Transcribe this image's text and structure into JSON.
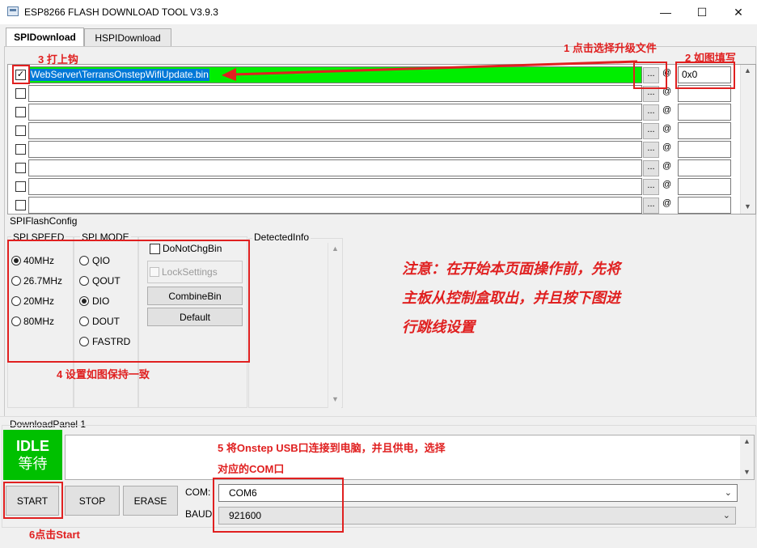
{
  "window": {
    "title": "ESP8266 FLASH DOWNLOAD TOOL V3.9.3",
    "minimize": "—",
    "maximize": "☐",
    "close": "✕"
  },
  "tabs": [
    {
      "label": "SPIDownload",
      "active": true
    },
    {
      "label": "HSPIDownload",
      "active": false
    }
  ],
  "files": [
    {
      "checked": true,
      "path": "WebServer\\TerransOnstepWifiUpdate.bin",
      "address": "0x0"
    },
    {
      "checked": false,
      "path": "",
      "address": ""
    },
    {
      "checked": false,
      "path": "",
      "address": ""
    },
    {
      "checked": false,
      "path": "",
      "address": ""
    },
    {
      "checked": false,
      "path": "",
      "address": ""
    },
    {
      "checked": false,
      "path": "",
      "address": ""
    },
    {
      "checked": false,
      "path": "",
      "address": ""
    },
    {
      "checked": false,
      "path": "",
      "address": ""
    }
  ],
  "browse_label": "...",
  "at_label": "@",
  "spiflash": {
    "title": "SPIFlashConfig",
    "speed_title": "SPI SPEED",
    "speeds": [
      "40MHz",
      "26.7MHz",
      "20MHz",
      "80MHz"
    ],
    "speed_selected": "40MHz",
    "mode_title": "SPI MODE",
    "modes": [
      "QIO",
      "QOUT",
      "DIO",
      "DOUT",
      "FASTRD"
    ],
    "mode_selected": "DIO",
    "do_not_chg_bin": "DoNotChgBin",
    "lock_settings": "LockSettings",
    "combine_bin": "CombineBin",
    "default": "Default",
    "detected_info": "DetectedInfo"
  },
  "annotations": {
    "a1": "1 点击选择升级文件",
    "a2": "2 如图填写",
    "a3": "3 打上钩",
    "a4": "4 设置如图保持一致",
    "a5_line1": "5 将Onstep USB口连接到电脑，并且供电，选择",
    "a5_line2": "对应的COM口",
    "a6": "6点击Start",
    "note_lines": [
      "注意：在开始本页面操作前，先将",
      "主板从控制盒取出，并且按下图进",
      "行跳线设置"
    ]
  },
  "download_panel": {
    "title": "DownloadPanel 1",
    "status_en": "IDLE",
    "status_cn": "等待",
    "status_color": "#00c000",
    "start": "START",
    "stop": "STOP",
    "erase": "ERASE",
    "com_label": "COM:",
    "com_value": "COM6",
    "baud_label": "BAUD:",
    "baud_value": "921600"
  },
  "colors": {
    "annotation_red": "#e02020",
    "selected_green": "#00ee00",
    "selection_blue": "#0078d7"
  }
}
